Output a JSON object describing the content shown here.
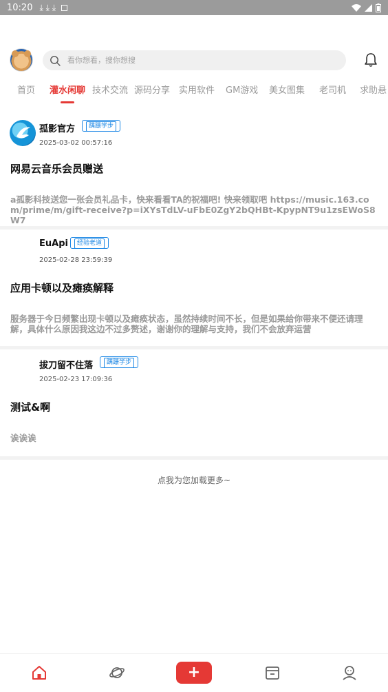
{
  "status_bar": {
    "time": "10:20",
    "downloads": "⤓ ⤓ ⤓"
  },
  "header": {
    "search_placeholder": "看你想看，搜你想搜"
  },
  "tabs": [
    {
      "label": "首页",
      "active": false
    },
    {
      "label": "灌水闲聊",
      "active": true
    },
    {
      "label": "技术交流",
      "active": false
    },
    {
      "label": "源码分享",
      "active": false
    },
    {
      "label": "实用软件",
      "active": false
    },
    {
      "label": "GM游戏",
      "active": false
    },
    {
      "label": "美女图集",
      "active": false
    },
    {
      "label": "老司机",
      "active": false
    },
    {
      "label": "求助悬",
      "active": false
    }
  ],
  "posts": [
    {
      "author": "孤影官方",
      "badge": "蹒跚学步",
      "time": "2025-03-02 00:57:16",
      "title": "网易云音乐会员赠送",
      "body": "a孤影科技送您一张会员礼品卡，快来看看TA的祝福吧! 快来领取吧 https://music.163.com/prime/m/gift-receive?p=iXYsTdLV-uFbE0ZgY2bQHBt-KpypNT9u1zsEWoS8W7"
    },
    {
      "author": "EuApi",
      "badge": "经验老道",
      "time": "2025-02-28 23:59:39",
      "title": "应用卡顿以及瘫痪解释",
      "body": "服务器于今日频繁出现卡顿以及瘫痪状态，虽然持续时间不长，但是如果给你带来不便还请理解，具体什么原因我这边不过多赘述，谢谢你的理解与支持，我们不会放弃运营"
    },
    {
      "author": "拔刀留不住落",
      "badge": "蹒跚学步",
      "time": "2025-02-23 17:09:36",
      "title": "测试&啊",
      "body": "诶诶诶"
    }
  ],
  "load_more": "点我为您加载更多~",
  "bottom_nav": {
    "plus_label": "+"
  },
  "colors": {
    "accent": "#e53935",
    "badge": "#1e88e5"
  }
}
